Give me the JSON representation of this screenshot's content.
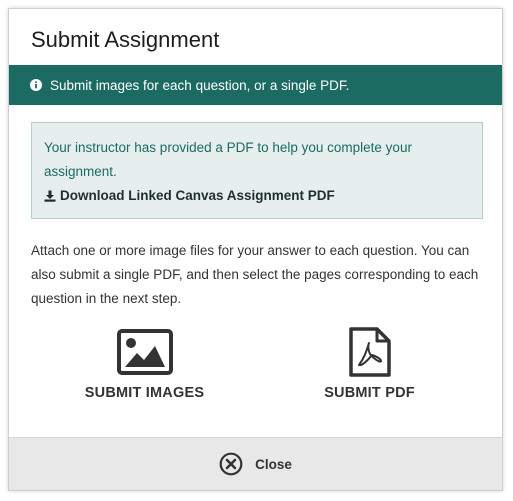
{
  "modal": {
    "title": "Submit Assignment"
  },
  "info_banner": {
    "icon": "info-circle-icon",
    "text": "Submit images for each question, or a single PDF."
  },
  "notice": {
    "text": "Your instructor has provided a PDF to help you complete your assignment.",
    "download_icon": "download-icon",
    "download_label": "Download Linked Canvas Assignment PDF"
  },
  "instructions": "Attach one or more image files for your answer to each question. You can also submit a single PDF, and then select the pages corresponding to each question in the next step.",
  "options": {
    "images": {
      "icon": "image-icon",
      "label": "SUBMIT IMAGES"
    },
    "pdf": {
      "icon": "pdf-file-icon",
      "label": "SUBMIT PDF"
    }
  },
  "footer": {
    "close_icon": "close-circle-icon",
    "close_label": "Close"
  },
  "colors": {
    "accent": "#1b6b63",
    "notice_bg": "#e6eeee",
    "footer_bg": "#e8e8e8",
    "text": "#333333"
  }
}
